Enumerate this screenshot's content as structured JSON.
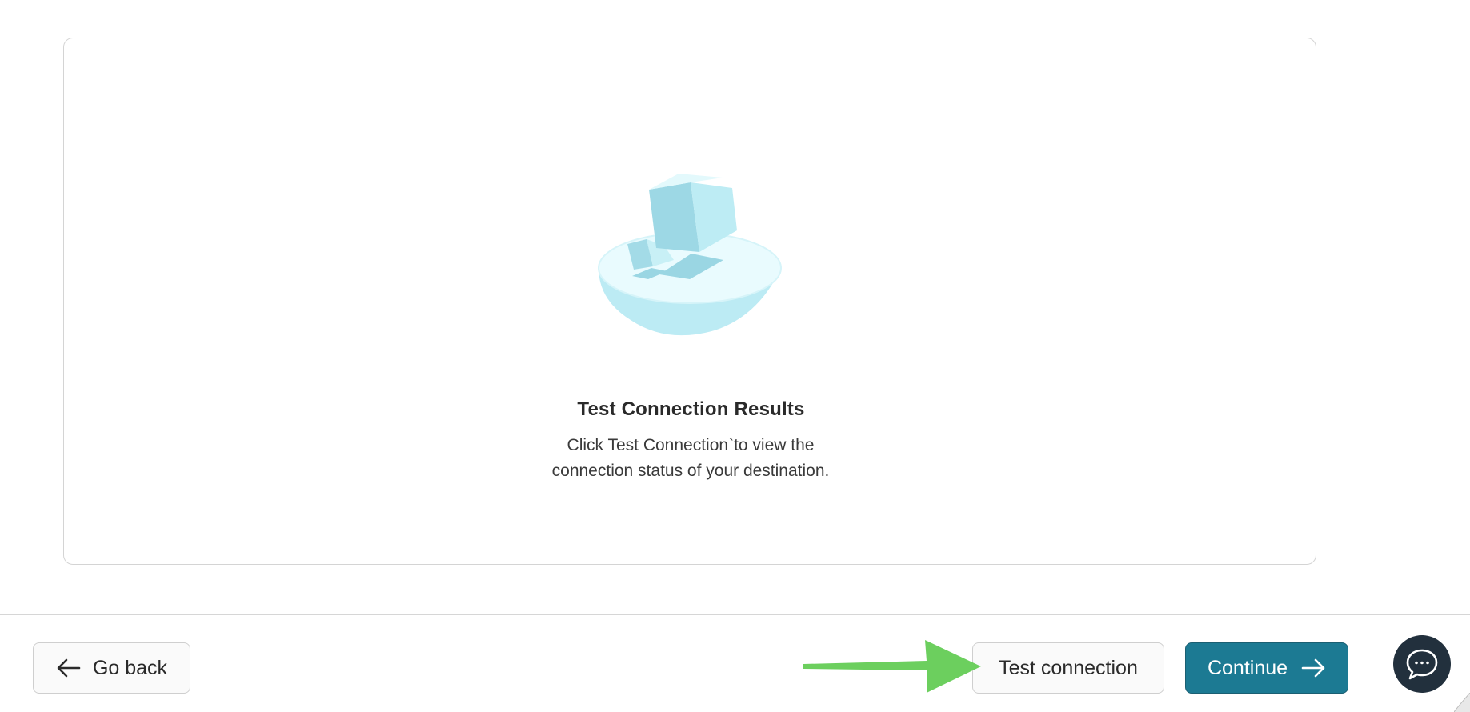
{
  "results": {
    "title": "Test Connection Results",
    "description": "Click Test Connection`to view the connection status of your destination."
  },
  "footer": {
    "back_label": "Go back",
    "test_label": "Test connection",
    "continue_label": "Continue"
  },
  "icons": {
    "back": "arrow-left-icon",
    "continue": "arrow-right-icon",
    "chat": "chat-bubble-icon",
    "illustration": "empty-state-cubes-illustration",
    "annotation": "green-pointer-arrow"
  },
  "colors": {
    "primary": "#1c7a93",
    "chat_bg": "#22303d",
    "annotation_arrow": "#6ccf5e",
    "illustration_light": "#c4eef6",
    "illustration_dark": "#97d6e3"
  }
}
